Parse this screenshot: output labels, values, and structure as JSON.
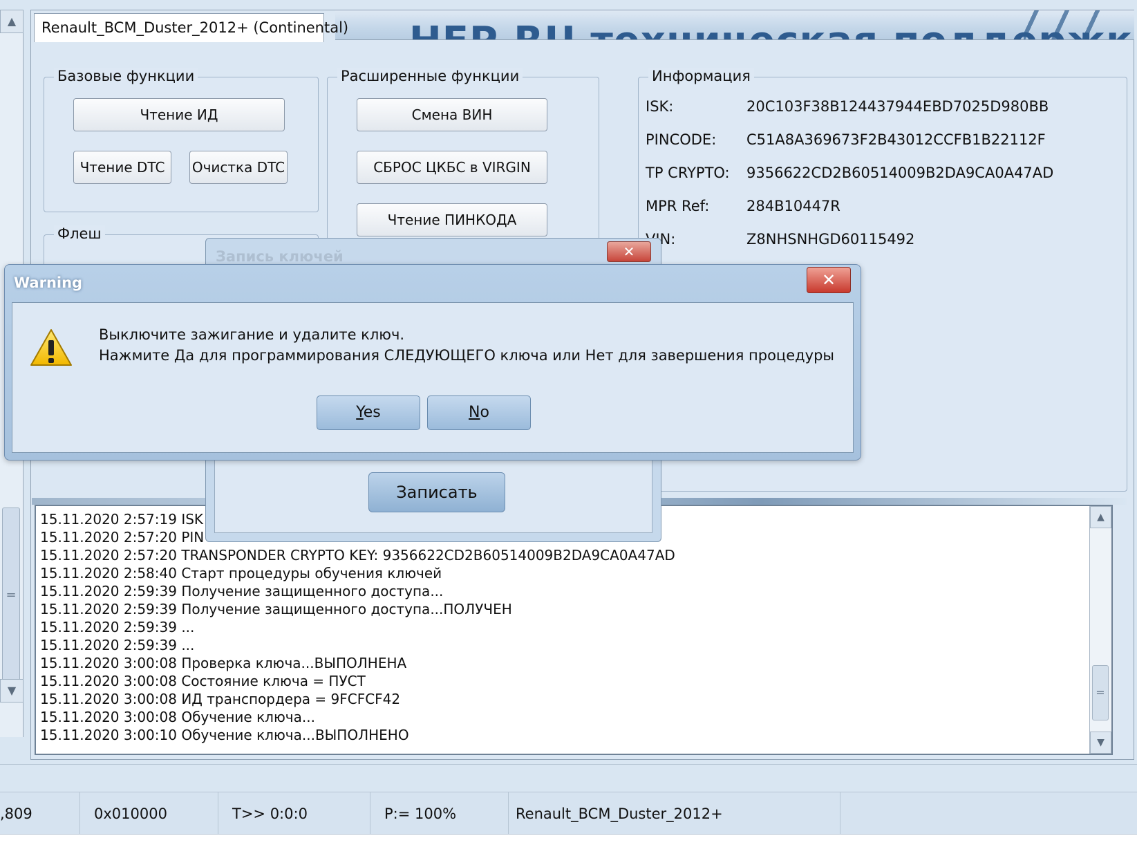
{
  "tab": {
    "label": "Renault_BCM_Duster_2012+ (Continental)"
  },
  "banner": {
    "text": "...НЕР.RU техническая поддержка"
  },
  "basic": {
    "title": "Базовые функции",
    "read_id": "Чтение ИД",
    "read_dtc": "Чтение DTC",
    "clear_dtc": "Очистка DTC"
  },
  "extended": {
    "title": "Расширенные функции",
    "change_vin": "Смена ВИН",
    "reset_virgin": "СБРОС ЦКБС в VIRGIN",
    "read_pin": "Чтение ПИНКОДА"
  },
  "flash": {
    "title": "Флеш"
  },
  "info": {
    "title": "Информация",
    "rows": [
      {
        "key": "ISK:",
        "value": "20C103F38B124437944EBD7025D980BB"
      },
      {
        "key": "PINCODE:",
        "value": "C51A8A369673F2B43012CCFB1B22112F"
      },
      {
        "key": "TP CRYPTO:",
        "value": "9356622CD2B60514009B2DA9CA0A47AD"
      },
      {
        "key": "MPR Ref:",
        "value": "284B10447R"
      },
      {
        "key": "VIN:",
        "value": "Z8NHSNHGD60115492"
      }
    ]
  },
  "log": [
    "15.11.2020 2:57:19  ISK",
    "15.11.2020 2:57:20  PIN",
    "15.11.2020 2:57:20  TRANSPONDER CRYPTO KEY: 9356622CD2B60514009B2DA9CA0A47AD",
    "15.11.2020 2:58:40  Старт процедуры обучения ключей",
    "15.11.2020 2:59:39  Получение защищенного доступа...",
    "15.11.2020 2:59:39  Получение защищенного доступа...ПОЛУЧЕН",
    "15.11.2020 2:59:39  ...",
    "15.11.2020 2:59:39  ...",
    "15.11.2020 3:00:08  Проверка ключа...ВЫПОЛНЕНА",
    "15.11.2020 3:00:08  Состояние ключа = ПУСТ",
    "15.11.2020 3:00:08  ИД транспордера = 9FCFCF42",
    "15.11.2020 3:00:08  Обучение ключа...",
    "15.11.2020 3:00:10  Обучение ключа...ВЫПОЛНЕНО"
  ],
  "status": {
    "c1": ",809",
    "c2": "0x010000",
    "c3": "T>> 0:0:0",
    "c4": "P:= 100%",
    "c5": "Renault_BCM_Duster_2012+"
  },
  "bg_dialog": {
    "title": "Запись ключей",
    "close": "✕",
    "write_button": "Записать"
  },
  "warning": {
    "title": "Warning",
    "close": "✕",
    "message_line1": "Выключите зажигание и удалите ключ.",
    "message_line2": "Нажмите Да для программирования СЛЕДУЮЩЕГО ключа или Нет для завершения процедуры",
    "yes_first": "Y",
    "yes_rest": "es",
    "no_first": "N",
    "no_rest": "o"
  }
}
